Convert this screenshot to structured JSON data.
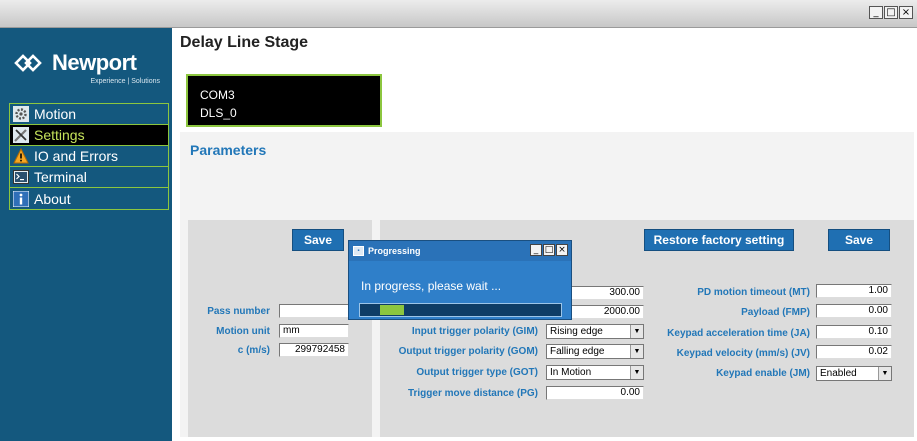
{
  "window": {
    "minimize": "_",
    "maximize": "□",
    "close": "×"
  },
  "brand": {
    "name": "Newport",
    "tagline": "Experience | Solutions"
  },
  "nav": [
    {
      "label": "Motion",
      "icon": "gear-icon",
      "active": false
    },
    {
      "label": "Settings",
      "icon": "tools-icon",
      "active": true
    },
    {
      "label": "IO and Errors",
      "icon": "warning-icon",
      "active": false
    },
    {
      "label": "Terminal",
      "icon": "terminal-icon",
      "active": false
    },
    {
      "label": "About",
      "icon": "info-icon",
      "active": false
    }
  ],
  "page": {
    "title": "Delay Line Stage"
  },
  "device": {
    "port": "COM3",
    "name": "DLS_0"
  },
  "parameters": {
    "title": "Parameters",
    "left": {
      "save_label": "Save",
      "pass_number_label": "Pass number",
      "pass_number_value": "",
      "motion_unit_label": "Motion unit",
      "motion_unit_value": "mm",
      "c_label": "c (m/s)",
      "c_value": "299792458"
    },
    "right": {
      "restore_label": "Restore factory setting",
      "save_label": "Save",
      "field1_value": "300.00",
      "field2_value": "2000.00",
      "input_trigger_polarity_label": "Input trigger polarity (GIM)",
      "input_trigger_polarity_value": "Rising edge",
      "output_trigger_polarity_label": "Output trigger polarity (GOM)",
      "output_trigger_polarity_value": "Falling edge",
      "output_trigger_type_label": "Output trigger type (GOT)",
      "output_trigger_type_value": "In Motion",
      "trigger_move_distance_label": "Trigger move distance (PG)",
      "trigger_move_distance_value": "0.00",
      "pd_motion_timeout_label": "PD motion timeout (MT)",
      "pd_motion_timeout_value": "1.00",
      "payload_label": "Payload (FMP)",
      "payload_value": "0.00",
      "keypad_accel_label": "Keypad acceleration time (JA)",
      "keypad_accel_value": "0.10",
      "keypad_velocity_label": "Keypad velocity (mm/s) (JV)",
      "keypad_velocity_value": "0.02",
      "keypad_enable_label": "Keypad enable (JM)",
      "keypad_enable_value": "Enabled"
    }
  },
  "dialog": {
    "title": "Progressing",
    "message": "In progress, please wait ...",
    "progress": {
      "start": 0.1,
      "end": 0.22
    }
  },
  "colors": {
    "sidebar": "#14587e",
    "accent_green": "#8cc63f",
    "label_blue": "#2277b8",
    "button_blue": "#1f6fb2"
  }
}
